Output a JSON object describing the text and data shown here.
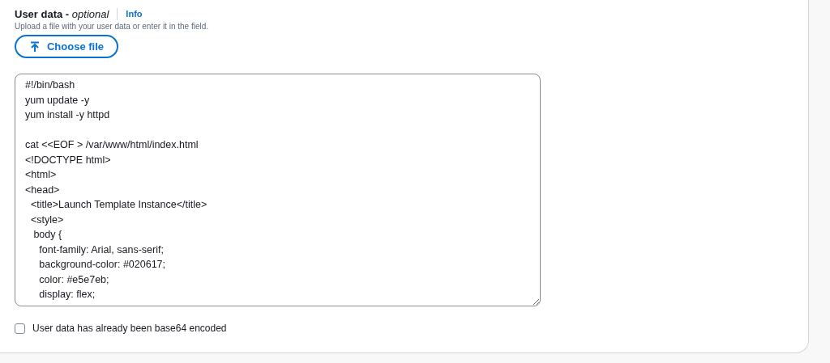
{
  "field": {
    "label": "User data - *optional*",
    "info_link": "Info",
    "description": "Upload a file with your user data or enter it in the field.",
    "upload_button": "Choose file",
    "value": "#!/bin/bash\nyum update -y\nyum install -y httpd\n\ncat <<EOF > /var/www/html/index.html\n<!DOCTYPE html>\n<html>\n<head>\n  <title>Launch Template Instance</title>\n  <style>\n   body {\n     font-family: Arial, sans-serif;\n     background-color: #020617;\n     color: #e5e7eb;\n     display: flex;",
    "checkbox": {
      "label": "User data has already been base64 encoded",
      "checked": false
    }
  }
}
